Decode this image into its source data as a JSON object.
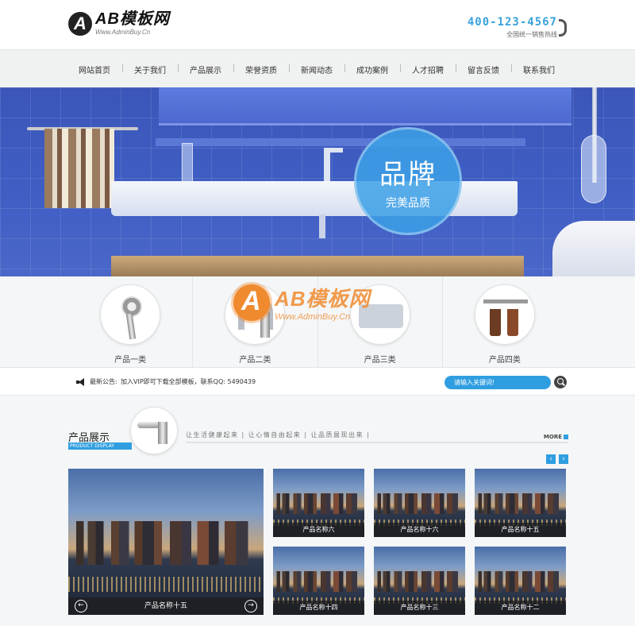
{
  "header": {
    "logo_title": "AB模板网",
    "logo_sub": "Www.AdminBuy.Cn",
    "phone": "400-123-4567",
    "phone_note": "全国统一销售热线"
  },
  "nav": {
    "items": [
      "网站首页",
      "关于我们",
      "产品展示",
      "荣誉资质",
      "新闻动态",
      "成功案例",
      "人才招聘",
      "留言反馈",
      "联系我们"
    ]
  },
  "banner": {
    "title": "品牌",
    "subtitle": "完美品质"
  },
  "categories": [
    {
      "label": "产品一类",
      "icon": "shower-icon"
    },
    {
      "label": "产品二类",
      "icon": "faucet-icon"
    },
    {
      "label": "产品三类",
      "icon": "sink-icon"
    },
    {
      "label": "产品四类",
      "icon": "towel-hook-icon"
    }
  ],
  "watermark": {
    "title": "AB模板网",
    "sub": "Www.AdminBuy.Cn"
  },
  "notice": {
    "label": "最新公告:",
    "text": "加入VIP即可下载全部模板，联系QQ: 5490439"
  },
  "search": {
    "placeholder": "请输入关键词!"
  },
  "products": {
    "title": "产品展示",
    "title_en": "PRODUCT DISPLAY",
    "slogan": "让生活健康起来 | 让心情自由起来 | 让品质展现出来 |",
    "more": "MORE",
    "prev": "‹",
    "next": "›",
    "featured": {
      "name": "产品名称十五",
      "prev": "←",
      "next": "→"
    },
    "items": [
      "产品名称六",
      "产品名称十六",
      "产品名称十五",
      "产品名称十四",
      "产品名称十三",
      "产品名称十二"
    ]
  },
  "colors": {
    "accent": "#2f9ee0",
    "banner_blue": "#3f5ec4",
    "watermark_orange": "#f08a2e"
  }
}
